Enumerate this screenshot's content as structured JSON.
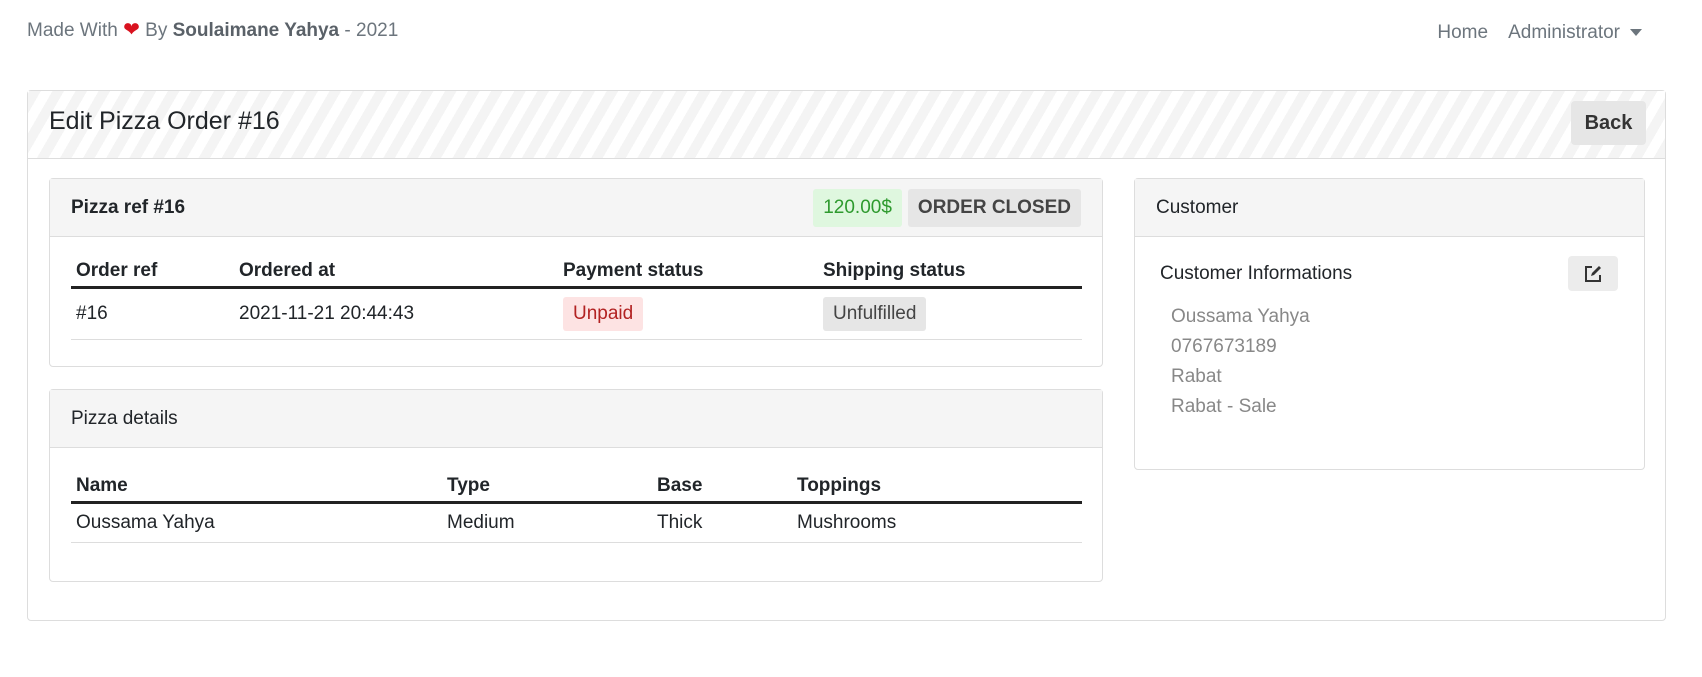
{
  "credit": {
    "prefix": "Made With",
    "heart": "❤",
    "by": "By",
    "author": "Soulaimane Yahya",
    "year": "- 2021"
  },
  "nav": {
    "home": "Home",
    "admin": "Administrator"
  },
  "page": {
    "title": "Edit Pizza Order #16",
    "back": "Back"
  },
  "order": {
    "title": "Pizza ref #16",
    "price": "120.00$",
    "status": "ORDER CLOSED",
    "headers": [
      "Order ref",
      "Ordered at",
      "Payment status",
      "Shipping status"
    ],
    "row": {
      "ref": "#16",
      "date": "2021-11-21 20:44:43",
      "payment": "Unpaid",
      "shipping": "Unfulfilled"
    }
  },
  "details": {
    "title": "Pizza details",
    "headers": [
      "Name",
      "Type",
      "Base",
      "Toppings"
    ],
    "row": [
      "Oussama Yahya",
      "Medium",
      "Thick",
      "Mushrooms"
    ]
  },
  "customer": {
    "title": "Customer",
    "subtitle": "Customer Informations",
    "info": [
      "Oussama Yahya",
      "0767673189",
      "Rabat",
      "Rabat - Sale"
    ]
  }
}
